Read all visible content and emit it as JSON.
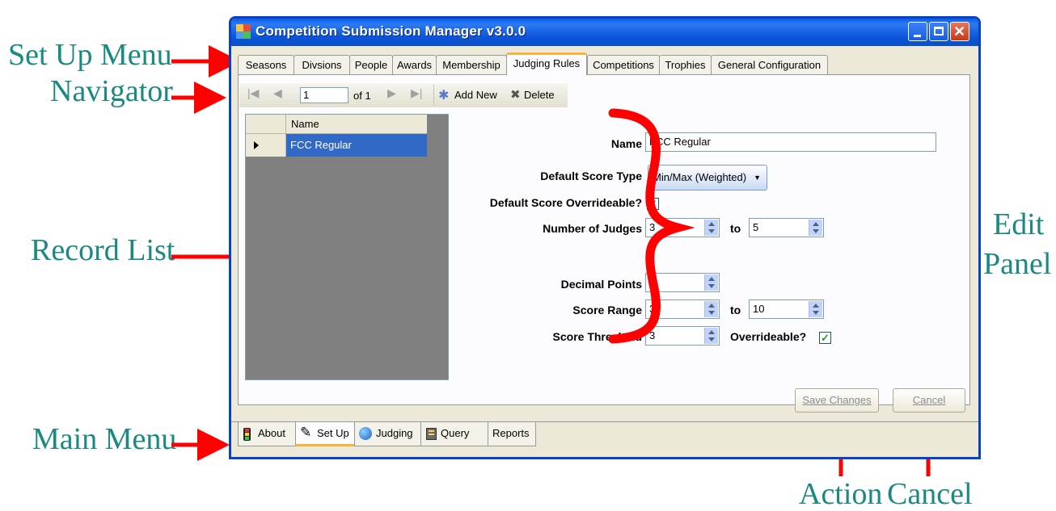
{
  "window": {
    "title": "Competition Submission Manager v3.0.0"
  },
  "setup_tabs": [
    {
      "label": "Seasons"
    },
    {
      "label": "Divsions"
    },
    {
      "label": "People"
    },
    {
      "label": "Awards"
    },
    {
      "label": "Membership"
    },
    {
      "label": "Judging Rules",
      "active": true
    },
    {
      "label": "Competitions"
    },
    {
      "label": "Trophies"
    },
    {
      "label": "General Configuration"
    }
  ],
  "navigator": {
    "position": "1",
    "count_label": "of 1",
    "add_new_label": "Add New",
    "delete_label": "Delete"
  },
  "record_list": {
    "column_header": "Name",
    "rows": [
      {
        "name": "FCC Regular",
        "selected": true
      }
    ]
  },
  "edit_panel": {
    "name_label": "Name",
    "name_value": "FCC Regular",
    "score_type_label": "Default Score Type",
    "score_type_value": "Min/Max (Weighted)",
    "overrideable_label": "Default Score Overrideable?",
    "overrideable_checked": "✓",
    "judges_label": "Number of Judges",
    "judges_min": "3",
    "judges_max": "5",
    "to_label": "to",
    "decimal_label": "Decimal Points",
    "decimal_value": "0",
    "range_label": "Score Range",
    "range_min": "3",
    "range_max": "10",
    "threshold_label": "Score Threshold",
    "threshold_value": "3",
    "threshold_overrideable_label": "Overrideable?",
    "threshold_overrideable_checked": "✓"
  },
  "actions": {
    "save_label": "Save Changes",
    "cancel_label": "Cancel"
  },
  "main_menu": [
    {
      "label": "About",
      "icon": "traffic-light-icon"
    },
    {
      "label": "Set Up",
      "icon": "pencil-icon",
      "active": true
    },
    {
      "label": "Judging",
      "icon": "globe-icon"
    },
    {
      "label": "Query",
      "icon": "query-icon"
    },
    {
      "label": "Reports"
    }
  ],
  "callouts": {
    "setup_menu": "Set Up Menu",
    "navigator": "Navigator",
    "record_list": "Record List",
    "main_menu": "Main Menu",
    "edit_line1": "Edit",
    "edit_line2": "Panel",
    "action": "Action",
    "cancel": "Cancel"
  },
  "colors": {
    "callout_text": "#1a8a80",
    "arrow": "#ff0000",
    "titlebar": "#0a5de8",
    "selection": "#3169c6",
    "active_tab_accent": "#f8b33b"
  }
}
